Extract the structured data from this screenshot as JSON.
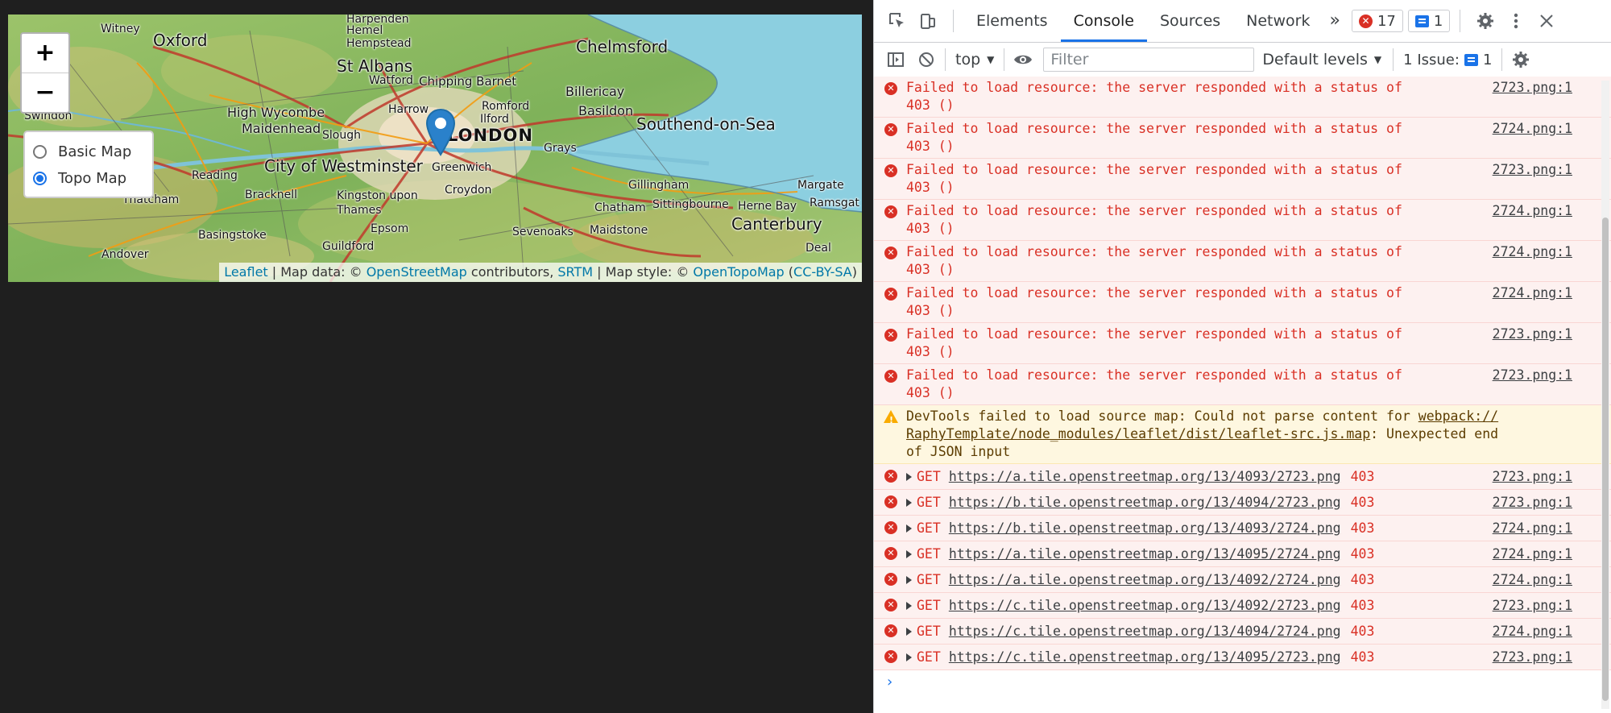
{
  "map": {
    "zoom_in": "+",
    "zoom_out": "−",
    "layers": [
      {
        "label": "Basic Map",
        "checked": false
      },
      {
        "label": "Topo Map",
        "checked": true
      }
    ],
    "places": {
      "oxford": "Oxford",
      "witney": "Witney",
      "swindon": "Swindon",
      "st_albans": "St Albans",
      "hemel": "Hemel\nHempstead",
      "harpenden": "Harpenden",
      "chelmsford": "Chelmsford",
      "watford": "Watford",
      "chipping_barnet": "Chipping Barnet",
      "billericay": "Billericay",
      "high_wycombe": "High Wycombe",
      "maidenhead": "Maidenhead",
      "harrow": "Harrow",
      "romford": "Romford",
      "basildon": "Basildon",
      "ilford": "Ilford",
      "southend": "Southend-on-Sea",
      "slough": "Slough",
      "london": "LONDON",
      "grays": "Grays",
      "westminster": "City of Westminster",
      "greenwich": "Greenwich",
      "reading": "Reading",
      "bracknell": "Bracknell",
      "kingston": "Kingston upon\nThames",
      "croydon": "Croydon",
      "gillingham": "Gillingham",
      "margate": "Margate",
      "chatham": "Chatham",
      "sittingbourne": "Sittingbourne",
      "herne_bay": "Herne Bay",
      "ramsgate": "Ramsgat",
      "basingstoke": "Basingstoke",
      "epsom": "Epsom",
      "sevenoaks": "Sevenoaks",
      "maidstone": "Maidstone",
      "canterbury": "Canterbury",
      "guildford": "Guildford",
      "andover": "Andover",
      "deal": "Deal",
      "thatcham": "Thatcham"
    },
    "attribution": {
      "leaflet": "Leaflet",
      "sep1": " | Map data: © ",
      "osm": "OpenStreetMap",
      "contributors": " contributors, ",
      "srtm": "SRTM",
      "sep2": " | Map style: © ",
      "opentopomap": "OpenTopoMap",
      "license_open": " (",
      "license": "CC-BY-SA",
      "license_close": ")"
    }
  },
  "devtools": {
    "tabs": [
      "Elements",
      "Console",
      "Sources",
      "Network"
    ],
    "active_tab": "Console",
    "more_tabs": "»",
    "error_count": "17",
    "message_count": "1",
    "toolbar": {
      "context": "top",
      "filter_placeholder": "Filter",
      "levels": "Default levels",
      "issues_label": "1 Issue:",
      "issues_count": "1"
    },
    "messages": [
      {
        "type": "error",
        "text": "Failed to load resource: the server responded with a status of\n403 ()",
        "source": "2723.png:1"
      },
      {
        "type": "error",
        "text": "Failed to load resource: the server responded with a status of\n403 ()",
        "source": "2724.png:1"
      },
      {
        "type": "error",
        "text": "Failed to load resource: the server responded with a status of\n403 ()",
        "source": "2723.png:1"
      },
      {
        "type": "error",
        "text": "Failed to load resource: the server responded with a status of\n403 ()",
        "source": "2724.png:1"
      },
      {
        "type": "error",
        "text": "Failed to load resource: the server responded with a status of\n403 ()",
        "source": "2724.png:1"
      },
      {
        "type": "error",
        "text": "Failed to load resource: the server responded with a status of\n403 ()",
        "source": "2724.png:1"
      },
      {
        "type": "error",
        "text": "Failed to load resource: the server responded with a status of\n403 ()",
        "source": "2723.png:1"
      },
      {
        "type": "error",
        "text": "Failed to load resource: the server responded with a status of\n403 ()",
        "source": "2723.png:1"
      }
    ],
    "warning": {
      "prefix": "DevTools failed to load source map: Could not parse content for ",
      "link": "webpack://\nRaphyTemplate/node_modules/leaflet/dist/leaflet-src.js.map",
      "suffix": ": Unexpected end\nof JSON input"
    },
    "network_errors": [
      {
        "method": "GET",
        "url": "https://a.tile.openstreetmap.org/13/4093/2723.png",
        "status": "403",
        "source": "2723.png:1"
      },
      {
        "method": "GET",
        "url": "https://b.tile.openstreetmap.org/13/4094/2723.png",
        "status": "403",
        "source": "2723.png:1"
      },
      {
        "method": "GET",
        "url": "https://b.tile.openstreetmap.org/13/4093/2724.png",
        "status": "403",
        "source": "2724.png:1"
      },
      {
        "method": "GET",
        "url": "https://a.tile.openstreetmap.org/13/4095/2724.png",
        "status": "403",
        "source": "2724.png:1"
      },
      {
        "method": "GET",
        "url": "https://a.tile.openstreetmap.org/13/4092/2724.png",
        "status": "403",
        "source": "2724.png:1"
      },
      {
        "method": "GET",
        "url": "https://c.tile.openstreetmap.org/13/4092/2723.png",
        "status": "403",
        "source": "2723.png:1"
      },
      {
        "method": "GET",
        "url": "https://c.tile.openstreetmap.org/13/4094/2724.png",
        "status": "403",
        "source": "2724.png:1"
      },
      {
        "method": "GET",
        "url": "https://c.tile.openstreetmap.org/13/4095/2723.png",
        "status": "403",
        "source": "2723.png:1"
      }
    ],
    "prompt": "›"
  }
}
